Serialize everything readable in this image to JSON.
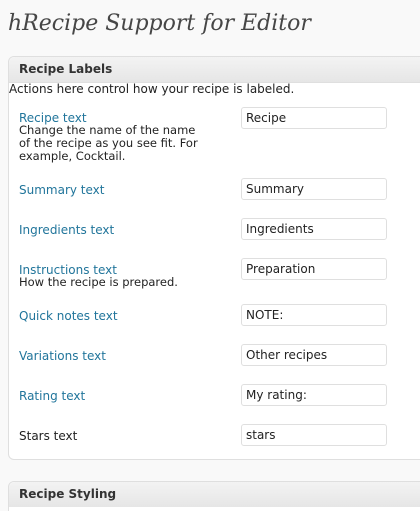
{
  "page": {
    "title": "hRecipe Support for Editor"
  },
  "labels_box": {
    "title": "Recipe Labels",
    "intro": "Actions here control how your recipe is labeled.",
    "rows": [
      {
        "label": "Recipe text",
        "description": "Change the name of the name of the recipe as you see fit. For example, Cocktail.",
        "value": "Recipe"
      },
      {
        "label": "Summary text",
        "value": "Summary"
      },
      {
        "label": "Ingredients text",
        "value": "Ingredients"
      },
      {
        "label": "Instructions text",
        "description": "How the recipe is prepared.",
        "value": "Preparation"
      },
      {
        "label": "Quick notes text",
        "value": "NOTE:"
      },
      {
        "label": "Variations text",
        "value": "Other recipes"
      },
      {
        "label": "Rating text",
        "value": "My rating:"
      },
      {
        "label": "Stars text",
        "value": "stars"
      }
    ]
  },
  "styling_box": {
    "title": "Recipe Styling"
  },
  "colors": {
    "link": "#21759b",
    "header_bg": "#e9e9e9",
    "border": "#dfdfdf"
  }
}
